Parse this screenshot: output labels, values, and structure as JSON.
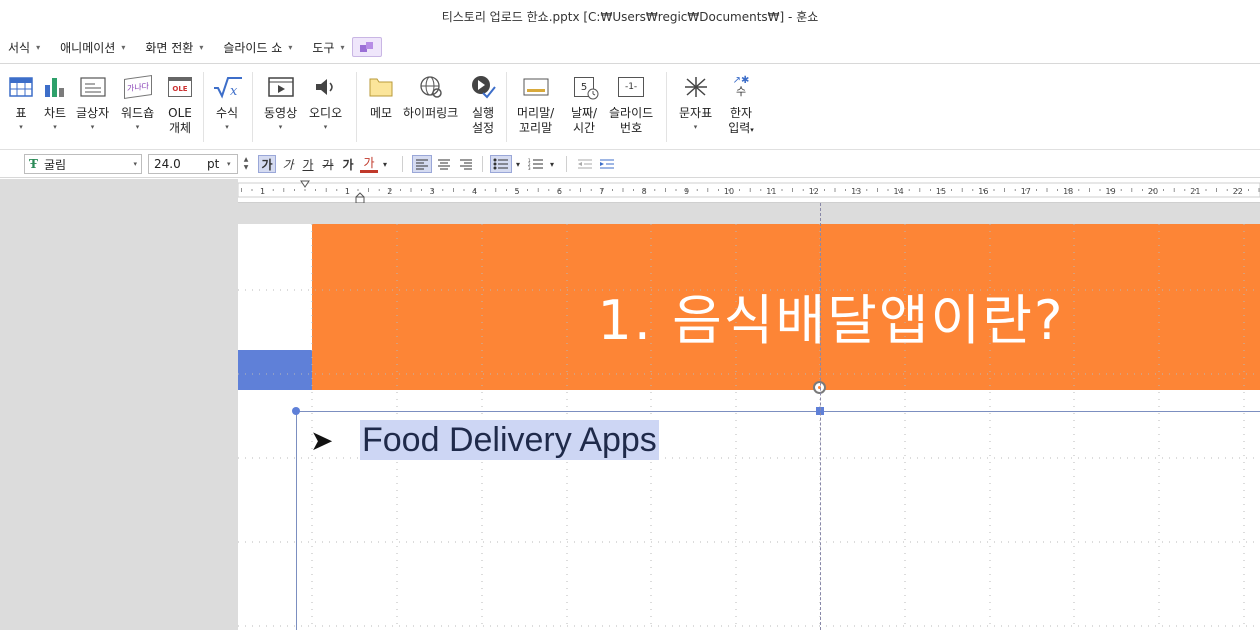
{
  "window": {
    "title": "티스토리 업로드 한쇼.pptx [C:₩Users₩regic₩Documents₩] - 훈쇼"
  },
  "menu": {
    "items": [
      {
        "label": "서식"
      },
      {
        "label": "애니메이션"
      },
      {
        "label": "화면 전환"
      },
      {
        "label": "슬라이드 쇼"
      },
      {
        "label": "도구"
      }
    ]
  },
  "ribbon": {
    "table": {
      "line1": "표"
    },
    "chart": {
      "line1": "차트"
    },
    "textbox": {
      "line1": "글상자"
    },
    "wordart": {
      "line1": "워드숍",
      "icon_text": "가나다"
    },
    "ole": {
      "line1": "OLE",
      "line2": "개체",
      "icon_text": "OLE"
    },
    "equation": {
      "line1": "수식"
    },
    "video": {
      "line1": "동영상"
    },
    "audio": {
      "line1": "오디오"
    },
    "memo": {
      "line1": "메모"
    },
    "hyperlink": {
      "line1": "하이퍼링크"
    },
    "action": {
      "line1": "실행",
      "line2": "설정"
    },
    "header_footer": {
      "line1": "머리말/",
      "line2": "꼬리말"
    },
    "datetime": {
      "line1": "날짜/",
      "line2": "시간",
      "icon_text": "5"
    },
    "slide_number": {
      "line1": "슬라이드",
      "line2": "번호",
      "icon_text": "-1-"
    },
    "symbol": {
      "line1": "문자표"
    },
    "hanja": {
      "line1": "한자",
      "line2": "입력",
      "icon_text": "수"
    }
  },
  "format": {
    "font_name": "굴림",
    "font_size": "24.0",
    "unit": "pt",
    "style_glyph": "가",
    "dropdown_glyph": "▾"
  },
  "ruler": {
    "labels": [
      "1",
      "1",
      "2",
      "3",
      "4",
      "5",
      "6",
      "7",
      "8",
      "9",
      "10",
      "11",
      "12",
      "13",
      "14",
      "15",
      "16",
      "17",
      "18",
      "19",
      "20",
      "21",
      "22"
    ]
  },
  "slide": {
    "title": "1. 음식배달앱이란?",
    "bullet_mark": "➤",
    "bullet_text": "Food Delivery Apps"
  },
  "colors": {
    "header": "#fd8536",
    "accent_block": "#5f80d8",
    "selection": "#cdd6f4"
  }
}
